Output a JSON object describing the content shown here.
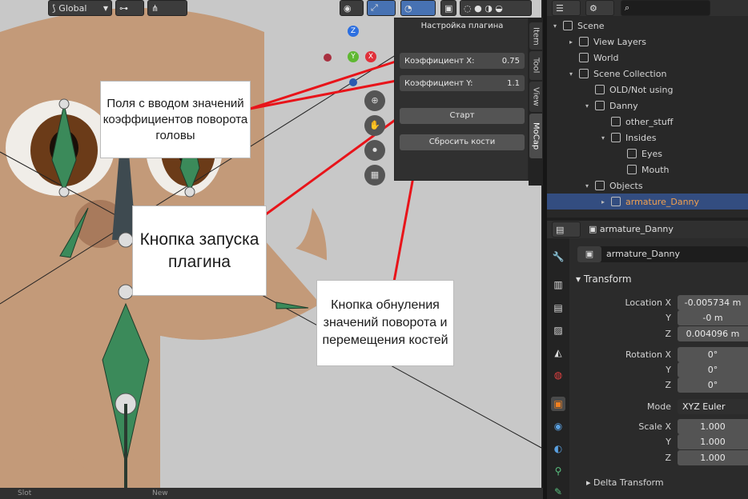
{
  "toolbar": {
    "transform_orientation": "Global"
  },
  "plugin": {
    "title": "Настройка плагина",
    "coef_x_label": "Коэффициент X:",
    "coef_x_value": "0.75",
    "coef_y_label": "Коэффициент Y:",
    "coef_y_value": "1.1",
    "start_label": "Старт",
    "reset_label": "Сбросить кости"
  },
  "sidebar_tabs": [
    "Item",
    "Tool",
    "View",
    "MoCap"
  ],
  "gizmo": {
    "z": "Z",
    "y": "Y",
    "x": "X"
  },
  "outliner": {
    "rows": [
      {
        "label": "Scene",
        "indent": 0,
        "expander": "▾"
      },
      {
        "label": "View Layers",
        "indent": 1,
        "expander": "▸"
      },
      {
        "label": "World",
        "indent": 1,
        "expander": ""
      },
      {
        "label": "Scene Collection",
        "indent": 1,
        "expander": "▾"
      },
      {
        "label": "OLD/Not using",
        "indent": 2,
        "expander": ""
      },
      {
        "label": "Danny",
        "indent": 2,
        "expander": "▾"
      },
      {
        "label": "other_stuff",
        "indent": 3,
        "expander": ""
      },
      {
        "label": "Insides",
        "indent": 3,
        "expander": "▾"
      },
      {
        "label": "Eyes",
        "indent": 4,
        "expander": ""
      },
      {
        "label": "Mouth",
        "indent": 4,
        "expander": ""
      },
      {
        "label": "Objects",
        "indent": 2,
        "expander": "▾"
      },
      {
        "label": "armature_Danny",
        "indent": 3,
        "expander": "▸",
        "selected": true
      }
    ]
  },
  "properties": {
    "object_name": "armature_Danny",
    "data_name": "armature_Danny",
    "transform_header": "Transform",
    "location_label": "Location X",
    "y_label": "Y",
    "z_label": "Z",
    "location": [
      "-0.005734 m",
      "-0 m",
      "0.004096 m"
    ],
    "rotation_label": "Rotation X",
    "rotation": [
      "0°",
      "0°",
      "0°"
    ],
    "mode_label": "Mode",
    "mode_value": "XYZ Euler",
    "scale_label": "Scale X",
    "scale": [
      "1.000",
      "1.000",
      "1.000"
    ],
    "delta_header": "Delta Transform"
  },
  "callouts": {
    "fields": "Поля с вводом значений коэффициентов поворота головы",
    "start": "Кнопка запуска плагина",
    "reset": "Кнопка обнуления значений поворота и перемещения костей"
  },
  "bottom": {
    "slot": "Slot",
    "new": "New"
  },
  "colors": {
    "selection": "#334d80",
    "annotation_line": "#e8141a",
    "bone_green": "#3b8a5a"
  }
}
